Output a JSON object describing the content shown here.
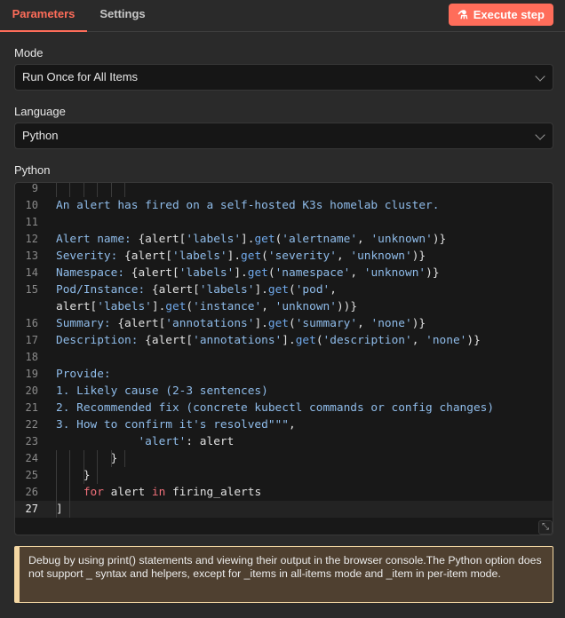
{
  "tabs": {
    "parameters": "Parameters",
    "settings": "Settings"
  },
  "execute_button": "Execute step",
  "mode": {
    "label": "Mode",
    "value": "Run Once for All Items"
  },
  "language": {
    "label": "Language",
    "value": "Python"
  },
  "editor": {
    "label": "Python",
    "active_line": 27,
    "lines": [
      {
        "n": "9",
        "t": []
      },
      {
        "n": "10",
        "t": [
          [
            "s",
            "An alert has fired on a self-hosted K3s homelab cluster."
          ]
        ]
      },
      {
        "n": "11",
        "t": []
      },
      {
        "n": "12",
        "t": [
          [
            "s",
            "Alert name: "
          ],
          [
            "p",
            "{alert["
          ],
          [
            "s",
            "'labels'"
          ],
          [
            "p",
            "]."
          ],
          [
            "f",
            "get"
          ],
          [
            "p",
            "("
          ],
          [
            "s",
            "'alertname'"
          ],
          [
            "p",
            ", "
          ],
          [
            "s",
            "'unknown'"
          ],
          [
            "p",
            ")}"
          ]
        ]
      },
      {
        "n": "13",
        "t": [
          [
            "s",
            "Severity: "
          ],
          [
            "p",
            "{alert["
          ],
          [
            "s",
            "'labels'"
          ],
          [
            "p",
            "]."
          ],
          [
            "f",
            "get"
          ],
          [
            "p",
            "("
          ],
          [
            "s",
            "'severity'"
          ],
          [
            "p",
            ", "
          ],
          [
            "s",
            "'unknown'"
          ],
          [
            "p",
            ")}"
          ]
        ]
      },
      {
        "n": "14",
        "t": [
          [
            "s",
            "Namespace: "
          ],
          [
            "p",
            "{alert["
          ],
          [
            "s",
            "'labels'"
          ],
          [
            "p",
            "]."
          ],
          [
            "f",
            "get"
          ],
          [
            "p",
            "("
          ],
          [
            "s",
            "'namespace'"
          ],
          [
            "p",
            ", "
          ],
          [
            "s",
            "'unknown'"
          ],
          [
            "p",
            ")}"
          ]
        ]
      },
      {
        "n": "15",
        "t": [
          [
            "s",
            "Pod/Instance: "
          ],
          [
            "p",
            "{alert["
          ],
          [
            "s",
            "'labels'"
          ],
          [
            "p",
            "]."
          ],
          [
            "f",
            "get"
          ],
          [
            "p",
            "("
          ],
          [
            "s",
            "'pod'"
          ],
          [
            "p",
            ","
          ]
        ]
      },
      {
        "n": "",
        "t": [
          [
            "p",
            "alert["
          ],
          [
            "s",
            "'labels'"
          ],
          [
            "p",
            "]."
          ],
          [
            "f",
            "get"
          ],
          [
            "p",
            "("
          ],
          [
            "s",
            "'instance'"
          ],
          [
            "p",
            ", "
          ],
          [
            "s",
            "'unknown'"
          ],
          [
            "p",
            "))}"
          ]
        ]
      },
      {
        "n": "16",
        "t": [
          [
            "s",
            "Summary: "
          ],
          [
            "p",
            "{alert["
          ],
          [
            "s",
            "'annotations'"
          ],
          [
            "p",
            "]."
          ],
          [
            "f",
            "get"
          ],
          [
            "p",
            "("
          ],
          [
            "s",
            "'summary'"
          ],
          [
            "p",
            ", "
          ],
          [
            "s",
            "'none'"
          ],
          [
            "p",
            ")}"
          ]
        ]
      },
      {
        "n": "17",
        "t": [
          [
            "s",
            "Description: "
          ],
          [
            "p",
            "{alert["
          ],
          [
            "s",
            "'annotations'"
          ],
          [
            "p",
            "]."
          ],
          [
            "f",
            "get"
          ],
          [
            "p",
            "("
          ],
          [
            "s",
            "'description'"
          ],
          [
            "p",
            ", "
          ],
          [
            "s",
            "'none'"
          ],
          [
            "p",
            ")}"
          ]
        ]
      },
      {
        "n": "18",
        "t": []
      },
      {
        "n": "19",
        "t": [
          [
            "s",
            "Provide:"
          ]
        ]
      },
      {
        "n": "20",
        "t": [
          [
            "s",
            "1. Likely cause (2-3 sentences)"
          ]
        ]
      },
      {
        "n": "21",
        "t": [
          [
            "s",
            "2. Recommended fix (concrete kubectl commands or config changes)"
          ]
        ]
      },
      {
        "n": "22",
        "t": [
          [
            "s",
            "3. How to confirm it's resolved\"\"\""
          ],
          [
            "p",
            ","
          ]
        ]
      },
      {
        "n": "23",
        "t": [
          [
            "p",
            "            "
          ],
          [
            "s",
            "'alert'"
          ],
          [
            "p",
            ": alert"
          ]
        ]
      },
      {
        "n": "24",
        "t": [
          [
            "p",
            "        }"
          ]
        ]
      },
      {
        "n": "25",
        "t": [
          [
            "p",
            "    }"
          ]
        ]
      },
      {
        "n": "26",
        "t": [
          [
            "p",
            "    "
          ],
          [
            "k",
            "for"
          ],
          [
            "p",
            " alert "
          ],
          [
            "k",
            "in"
          ],
          [
            "p",
            " firing_alerts"
          ]
        ]
      },
      {
        "n": "27",
        "t": [
          [
            "p",
            "]"
          ]
        ]
      }
    ]
  },
  "notice": "Debug by using print() statements and viewing their output in the browser console.The Python option does not support _ syntax and helpers, except for _items in all-items mode and _item in per-item mode."
}
